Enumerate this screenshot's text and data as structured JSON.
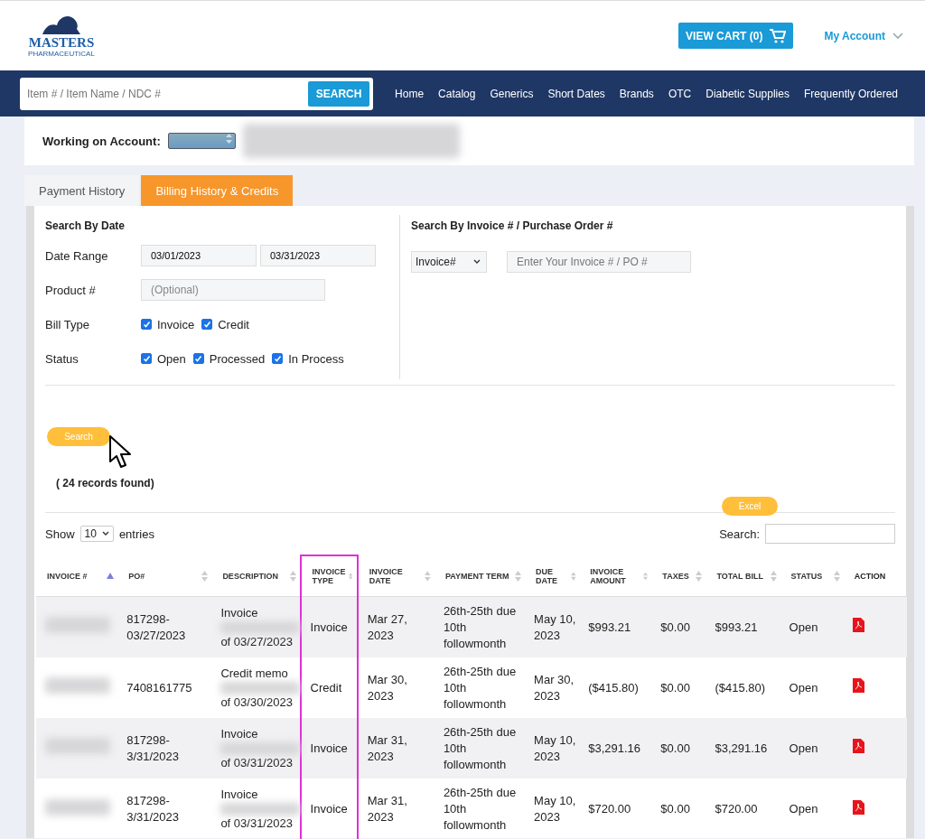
{
  "header": {
    "logo": {
      "name": "MASTERS",
      "tagline": "PHARMACEUTICAL"
    },
    "cart_button": "VIEW CART (0)",
    "account_menu": "My Account"
  },
  "navbar": {
    "search": {
      "placeholder": "Item # / Item Name / NDC #",
      "button": "SEARCH"
    },
    "links": [
      "Home",
      "Catalog",
      "Generics",
      "Short Dates",
      "Brands",
      "OTC",
      "Diabetic Supplies",
      "Frequently Ordered"
    ]
  },
  "account": {
    "label": "Working on Account:"
  },
  "tabs": [
    {
      "label": "Payment History",
      "selected": false
    },
    {
      "label": "Billing History & Credits",
      "selected": true
    }
  ],
  "date_search": {
    "title": "Search By Date",
    "date_range_label": "Date Range",
    "date_from": "03/01/2023",
    "date_to": "03/31/2023",
    "product_label": "Product #",
    "product_placeholder": "(Optional)",
    "bill_type_label": "Bill Type",
    "bill_types": [
      {
        "label": "Invoice",
        "checked": true
      },
      {
        "label": "Credit",
        "checked": true
      }
    ],
    "status_label": "Status",
    "statuses": [
      {
        "label": "Open",
        "checked": true
      },
      {
        "label": "Processed",
        "checked": true
      },
      {
        "label": "In Process",
        "checked": true
      }
    ]
  },
  "invoice_search": {
    "title": "Search By Invoice # / Purchase Order #",
    "type_select": "Invoice#",
    "placeholder": "Enter Your Invoice # / PO #"
  },
  "search_button": "Search",
  "records_found": "( 24 records found)",
  "excel_button": "Excel",
  "table_controls": {
    "show_label": "Show",
    "page_size": "10",
    "entries_label": "entries",
    "search_label": "Search:"
  },
  "table": {
    "columns": [
      {
        "label": "INVOICE #",
        "sortable": true,
        "sorted_ascending": true,
        "highlighted": false
      },
      {
        "label": "PO#",
        "sortable": true,
        "sorted_ascending": false,
        "highlighted": false
      },
      {
        "label": "DESCRIPTION",
        "sortable": true,
        "sorted_ascending": false,
        "highlighted": false
      },
      {
        "label": "INVOICE TYPE",
        "sortable": true,
        "sorted_ascending": false,
        "highlighted": true
      },
      {
        "label": "INVOICE DATE",
        "sortable": true,
        "sorted_ascending": false,
        "highlighted": false
      },
      {
        "label": "PAYMENT TERM",
        "sortable": true,
        "sorted_ascending": false,
        "highlighted": false
      },
      {
        "label": "DUE DATE",
        "sortable": true,
        "sorted_ascending": false,
        "highlighted": false
      },
      {
        "label": "INVOICE AMOUNT",
        "sortable": true,
        "sorted_ascending": false,
        "highlighted": false
      },
      {
        "label": "TAXES",
        "sortable": true,
        "sorted_ascending": false,
        "highlighted": false
      },
      {
        "label": "TOTAL BILL",
        "sortable": true,
        "sorted_ascending": false,
        "highlighted": false
      },
      {
        "label": "STATUS",
        "sortable": true,
        "sorted_ascending": false,
        "highlighted": false
      },
      {
        "label": "ACTION",
        "sortable": false,
        "sorted_ascending": false,
        "highlighted": false
      }
    ],
    "rows": [
      {
        "po": "817298-03/27/2023",
        "desc_top": "Invoice",
        "desc_bottom": "of 03/27/2023",
        "type": "Invoice",
        "date": "Mar 27, 2023",
        "term": "26th-25th due 10th followmonth",
        "due": "May 10, 2023",
        "amount": "$993.21",
        "taxes": "$0.00",
        "total": "$993.21",
        "status": "Open"
      },
      {
        "po": "7408161775",
        "desc_top": "Credit memo",
        "desc_bottom": "of 03/30/2023",
        "type": "Credit",
        "date": "Mar 30, 2023",
        "term": "26th-25th due 10th followmonth",
        "due": "Mar 30, 2023",
        "amount": "($415.80)",
        "taxes": "$0.00",
        "total": "($415.80)",
        "status": "Open"
      },
      {
        "po": "817298-3/31/2023",
        "desc_top": "Invoice",
        "desc_bottom": "of 03/31/2023",
        "type": "Invoice",
        "date": "Mar 31, 2023",
        "term": "26th-25th due 10th followmonth",
        "due": "May 10, 2023",
        "amount": "$3,291.16",
        "taxes": "$0.00",
        "total": "$3,291.16",
        "status": "Open"
      },
      {
        "po": "817298-3/31/2023",
        "desc_top": "Invoice",
        "desc_bottom": "of 03/31/2023",
        "type": "Invoice",
        "date": "Mar 31, 2023",
        "term": "26th-25th due 10th followmonth",
        "due": "May 10, 2023",
        "amount": "$720.00",
        "taxes": "$0.00",
        "total": "$720.00",
        "status": "Open"
      }
    ]
  }
}
